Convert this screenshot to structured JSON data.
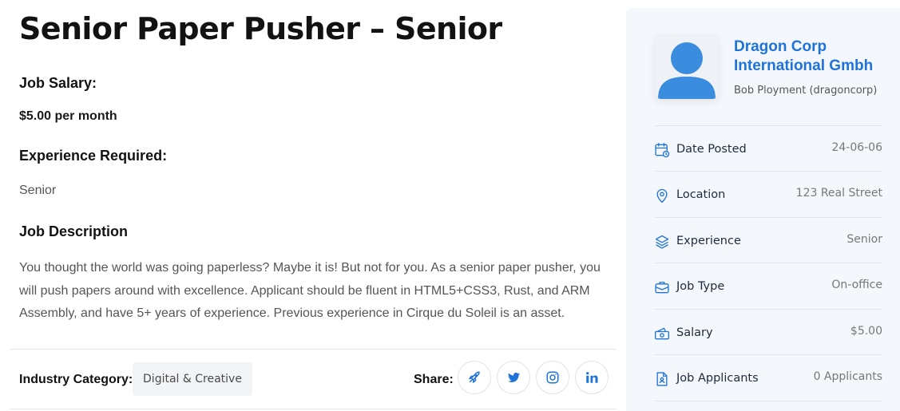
{
  "job": {
    "title": "Senior Paper Pusher – Senior",
    "salary_heading": "Job Salary:",
    "salary_value": "$5.00 per month",
    "experience_heading": "Experience Required:",
    "experience_value": "Senior",
    "description_heading": "Job Description",
    "description": "You thought the world was going paperless? Maybe it is! But not for you. As a senior paper pusher, you will push papers around with excellence. Applicant should be fluent in HTML5+CSS3, Rust, and ARM Assembly, and have 5+ years of experience. Previous experience in Cirque du Soleil is an asset.",
    "industry_label": "Industry Category:",
    "industry_value": "Digital & Creative",
    "share_label": "Share:",
    "share_icons": [
      "rocket-icon",
      "twitter-icon",
      "instagram-icon",
      "linkedin-icon"
    ]
  },
  "sidebar": {
    "company_name": "Dragon Corp International Gmbh",
    "owner": "Bob Ployment (dragoncorp)",
    "details": [
      {
        "icon": "calendar-icon",
        "label": "Date Posted",
        "value": "24-06-06"
      },
      {
        "icon": "location-pin-icon",
        "label": "Location",
        "value": "123 Real Street"
      },
      {
        "icon": "layers-icon",
        "label": "Experience",
        "value": "Senior"
      },
      {
        "icon": "briefcase-icon",
        "label": "Job Type",
        "value": "On-office"
      },
      {
        "icon": "money-icon",
        "label": "Salary",
        "value": "$5.00"
      },
      {
        "icon": "document-user-icon",
        "label": "Job Applicants",
        "value": "0 Applicants"
      }
    ]
  },
  "colors": {
    "accent": "#1f73d8",
    "sidebar_bg": "#f4f8fd",
    "heading": "#121212",
    "muted_text": "#555555"
  }
}
